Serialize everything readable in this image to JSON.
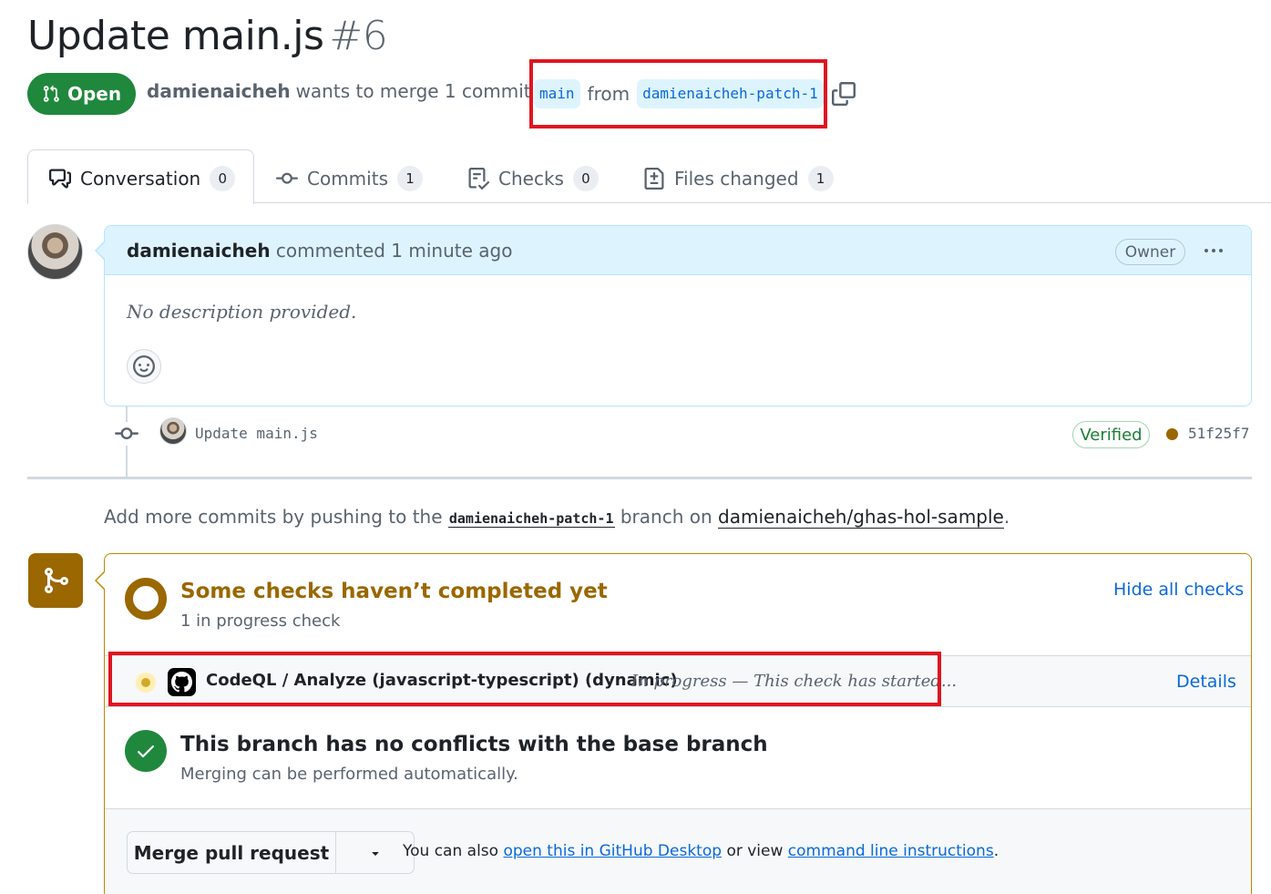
{
  "header": {
    "title": "Update main.js",
    "number": "#6",
    "state": "Open",
    "author": "damienaicheh",
    "merge_text": "wants to merge 1 commit into",
    "base_branch": "main",
    "from_text": "from",
    "head_branch": "damienaicheh-patch-1"
  },
  "tabs": [
    {
      "label": "Conversation",
      "count": "0",
      "icon": "comment-discussion-icon"
    },
    {
      "label": "Commits",
      "count": "1",
      "icon": "git-commit-icon"
    },
    {
      "label": "Checks",
      "count": "0",
      "icon": "checklist-icon"
    },
    {
      "label": "Files changed",
      "count": "1",
      "icon": "file-diff-icon"
    }
  ],
  "comment": {
    "author": "damienaicheh",
    "action": "commented 1 minute ago",
    "role": "Owner",
    "body": "No description provided."
  },
  "commit": {
    "message": "Update main.js",
    "verified": "Verified",
    "sha": "51f25f7"
  },
  "hint": {
    "prefix": "Add more commits by pushing to the",
    "branch": "damienaicheh-patch-1",
    "middle": "branch on",
    "repo": "damienaicheh/ghas-hol-sample",
    "suffix": "."
  },
  "checks": {
    "title": "Some checks haven’t completed yet",
    "subtitle": "1 in progress check",
    "hide_label": "Hide all checks",
    "items": [
      {
        "name": "CodeQL / Analyze (javascript-typescript) (dynamic)",
        "status": "In progress — This check has started...",
        "details": "Details"
      }
    ]
  },
  "conflicts": {
    "title": "This branch has no conflicts with the base branch",
    "subtitle": "Merging can be performed automatically."
  },
  "merge": {
    "button": "Merge pull request",
    "text_prefix": "You can also",
    "desktop_link": "open this in GitHub Desktop",
    "text_middle": "or view",
    "cli_link": "command line instructions",
    "text_suffix": "."
  },
  "colors": {
    "open_green": "#1f883d",
    "link_blue": "#0969da",
    "pending_amber": "#9a6700",
    "highlight_red": "#e0151f"
  }
}
